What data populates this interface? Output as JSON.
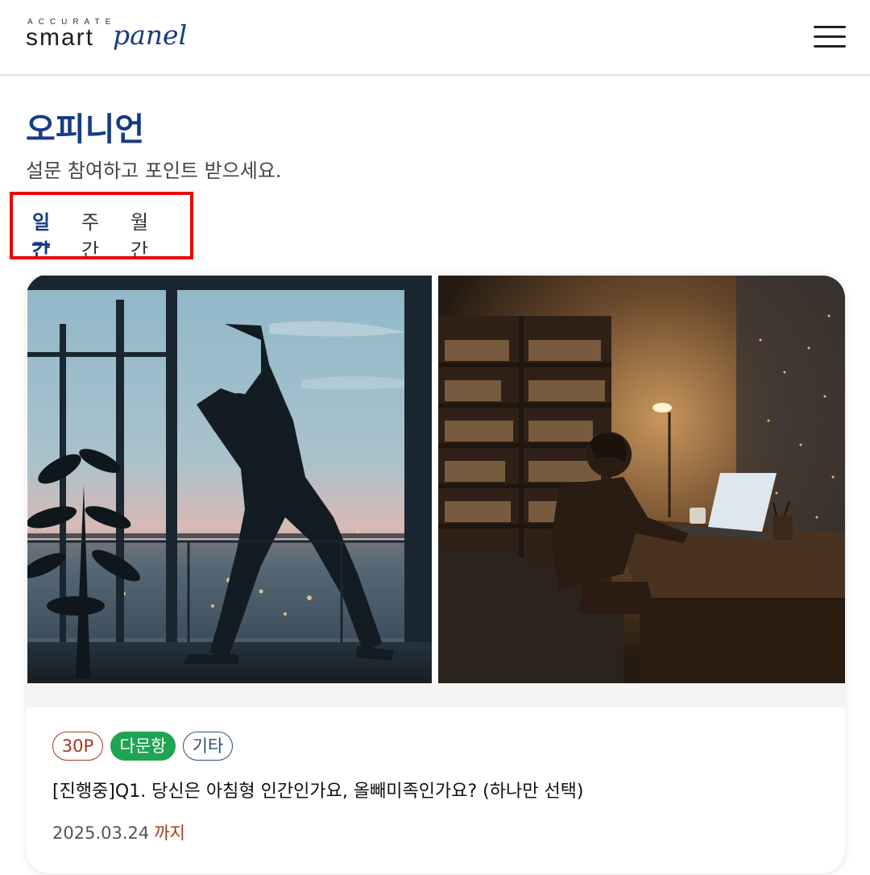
{
  "header": {
    "logo": {
      "small": "ACCURATE",
      "smart": "smart",
      "panel": "panel"
    },
    "menu_icon": "hamburger-menu-icon"
  },
  "page": {
    "title": "오피니언",
    "subtitle": "설문 참여하고 포인트 받으세요."
  },
  "tabs": [
    {
      "label": "일간",
      "active": true
    },
    {
      "label": "주간",
      "active": false
    },
    {
      "label": "월간",
      "active": false
    }
  ],
  "card": {
    "tags": {
      "points": "30P",
      "type": "다문항",
      "category": "기타"
    },
    "title": "[진행중]Q1. 당신은 아침형 인간인가요, 올빼미족인가요? (하나만 선택)",
    "deadline": {
      "date": "2025.03.24",
      "suffix": "까지"
    }
  },
  "colors": {
    "brand": "#173b86",
    "points_tag": "#a5361d",
    "type_tag_bg": "#1ea453",
    "category_tag": "#2b4f74",
    "highlight_box": "#ee0000"
  }
}
